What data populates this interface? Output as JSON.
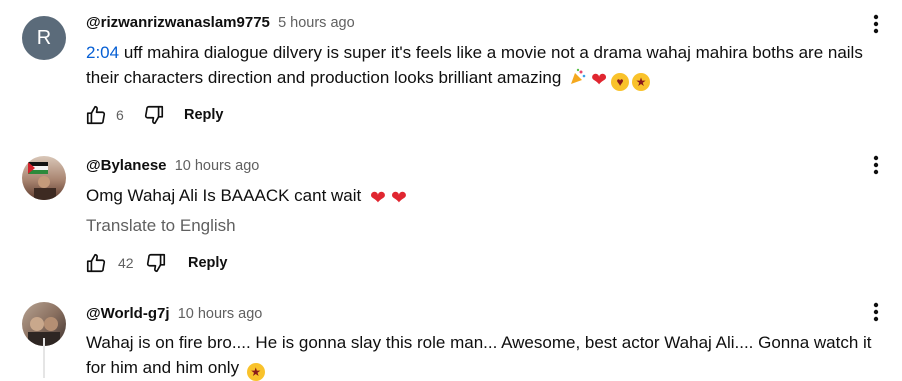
{
  "comments": [
    {
      "avatar_letter": "R",
      "author": "@rizwanrizwanaslam9775",
      "time": "5 hours ago",
      "timestamp_link": "2:04",
      "text": " uff mahira dialogue dilvery is super it's feels like a movie not a drama wahaj mahira boths are nails their characters direction and production looks brilliant amazing",
      "likes": "6",
      "reply_label": "Reply"
    },
    {
      "author": "@Bylanese",
      "time": "10 hours ago",
      "text": "Omg Wahaj Ali Is BAAACK cant wait",
      "translate_label": "Translate to English",
      "likes": "42",
      "reply_label": "Reply"
    },
    {
      "author": "@World-g7j",
      "time": "10 hours ago",
      "text": "Wahaj is on fire bro.... He is gonna slay this role man... Awesome, best actor Wahaj Ali.... Gonna watch it for him and him only"
    }
  ],
  "colors": {
    "link": "#065fd4",
    "secondary": "#606060",
    "primary": "#0f0f0f"
  }
}
